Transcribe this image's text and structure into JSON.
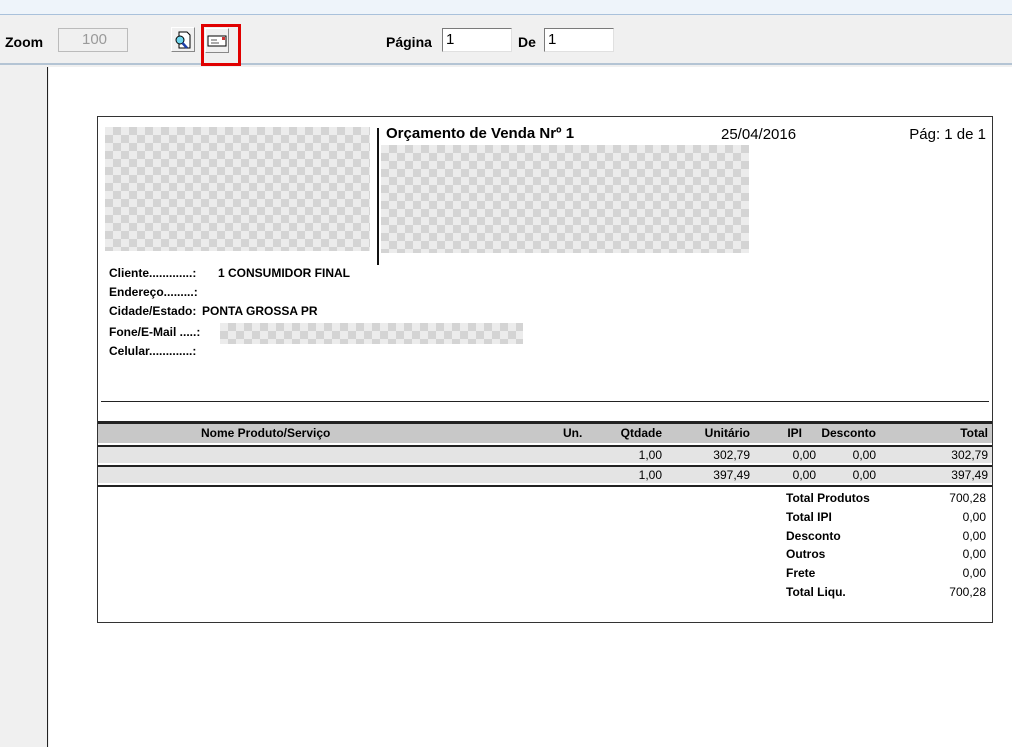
{
  "toolbar": {
    "zoom_label": "Zoom",
    "zoom_value": "100",
    "page_label": "Página",
    "page_value": "1",
    "of_label": "De",
    "of_value": "1"
  },
  "report": {
    "title": "Orçamento de Venda Nrº  1",
    "date": "25/04/2016",
    "page": "Pág: 1 de 1",
    "client": [
      {
        "label": "Cliente.............:",
        "value": "1 CONSUMIDOR FINAL"
      },
      {
        "label": "Endereço.........:",
        "value": ""
      },
      {
        "label": "Cidade/Estado:",
        "value": "PONTA GROSSA PR"
      },
      {
        "label": "Fone/E-Mail .....:",
        "value": ""
      },
      {
        "label": "Celular.............:",
        "value": ""
      }
    ],
    "columns": {
      "name": "Nome Produto/Serviço",
      "un": "Un.",
      "qty": "Qtdade",
      "unit": "Unitário",
      "ipi": "IPI",
      "disc": "Desconto",
      "total": "Total"
    },
    "items": [
      {
        "name": "",
        "un": "",
        "qty": "1,00",
        "unit": "302,79",
        "ipi": "0,00",
        "disc": "0,00",
        "total": "302,79"
      },
      {
        "name": "",
        "un": "",
        "qty": "1,00",
        "unit": "397,49",
        "ipi": "0,00",
        "disc": "0,00",
        "total": "397,49"
      }
    ],
    "totals": [
      {
        "label": "Total Produtos",
        "value": "700,28"
      },
      {
        "label": "Total IPI",
        "value": "0,00"
      },
      {
        "label": "Desconto",
        "value": "0,00"
      },
      {
        "label": "Outros",
        "value": "0,00"
      },
      {
        "label": "Frete",
        "value": "0,00"
      },
      {
        "label": "Total Liqu.",
        "value": "700,28"
      }
    ]
  }
}
